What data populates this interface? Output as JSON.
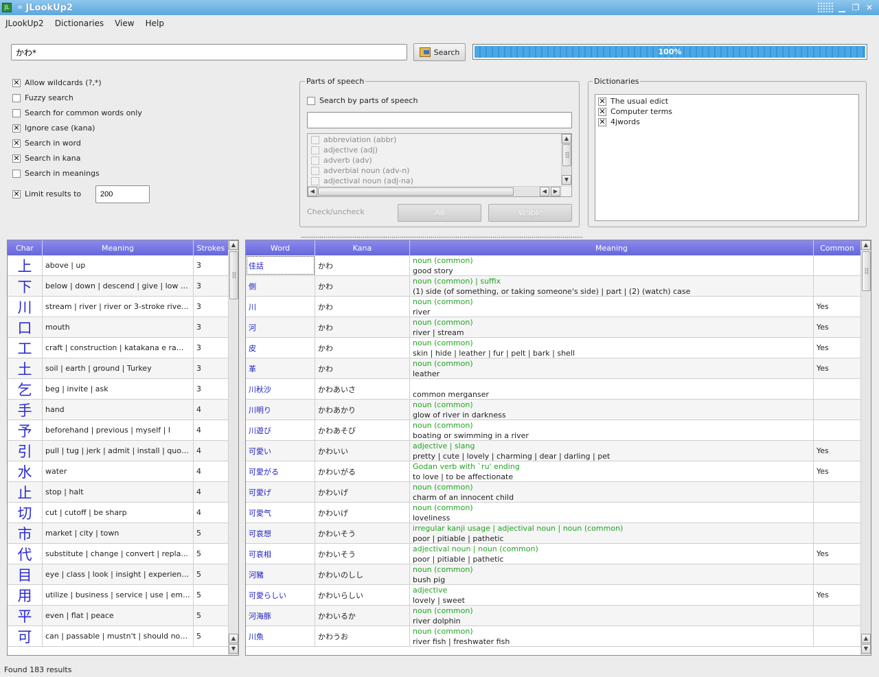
{
  "window": {
    "title": "JLookUp2"
  },
  "menu": [
    "JLookUp2",
    "Dictionaries",
    "View",
    "Help"
  ],
  "search": {
    "value": "かわ*",
    "button_label": "Search"
  },
  "progress": {
    "label": "100%",
    "value": 1.0
  },
  "options": [
    {
      "label": "Allow wildcards (?,*)",
      "checked": true
    },
    {
      "label": "Fuzzy search",
      "checked": false
    },
    {
      "label": "Search for common words only",
      "checked": false
    },
    {
      "label": "Ignore case (kana)",
      "checked": true
    },
    {
      "label": "Search in word",
      "checked": true
    },
    {
      "label": "Search in kana",
      "checked": true
    },
    {
      "label": "Search in meanings",
      "checked": false
    }
  ],
  "limit": {
    "label": "Limit results to",
    "checked": true,
    "value": "200"
  },
  "parts_of_speech": {
    "title": "Parts of speech",
    "search_by_label": "Search by parts of speech",
    "filter_value": "",
    "items": [
      "abbreviation (abbr)",
      "adjective (adj)",
      "adverb (adv)",
      "adverbial noun (adv-n)",
      "adjectival noun (adj-na)"
    ],
    "check_label": "Check/uncheck",
    "all_button": "All",
    "visible_button": "Visible"
  },
  "dictionaries": {
    "title": "Dictionaries",
    "items": [
      {
        "label": "The usual edict",
        "checked": true
      },
      {
        "label": "Computer terms",
        "checked": true
      },
      {
        "label": "4jwords",
        "checked": true
      }
    ]
  },
  "kanji_table": {
    "headers": [
      "Char",
      "Meaning",
      "Strokes"
    ],
    "rows": [
      {
        "char": "上",
        "meaning": "above | up",
        "strokes": "3"
      },
      {
        "char": "下",
        "meaning": "below | down | descend | give | low | i...",
        "strokes": "3"
      },
      {
        "char": "川",
        "meaning": "stream | river | river or 3-stroke rive...",
        "strokes": "3"
      },
      {
        "char": "口",
        "meaning": "mouth",
        "strokes": "3"
      },
      {
        "char": "工",
        "meaning": "craft | construction | katakana e ra...",
        "strokes": "3"
      },
      {
        "char": "土",
        "meaning": "soil | earth | ground | Turkey",
        "strokes": "3"
      },
      {
        "char": "乞",
        "meaning": "beg | invite | ask",
        "strokes": "3"
      },
      {
        "char": "手",
        "meaning": "hand",
        "strokes": "4"
      },
      {
        "char": "予",
        "meaning": "beforehand | previous | myself | I",
        "strokes": "4"
      },
      {
        "char": "引",
        "meaning": "pull | tug | jerk | admit | install | quot...",
        "strokes": "4"
      },
      {
        "char": "水",
        "meaning": "water",
        "strokes": "4"
      },
      {
        "char": "止",
        "meaning": "stop | halt",
        "strokes": "4"
      },
      {
        "char": "切",
        "meaning": "cut | cutoff | be sharp",
        "strokes": "4"
      },
      {
        "char": "市",
        "meaning": "market | city | town",
        "strokes": "5"
      },
      {
        "char": "代",
        "meaning": "substitute | change | convert | repla...",
        "strokes": "5"
      },
      {
        "char": "目",
        "meaning": "eye | class | look | insight | experienc...",
        "strokes": "5"
      },
      {
        "char": "用",
        "meaning": "utilize | business | service | use | em...",
        "strokes": "5"
      },
      {
        "char": "平",
        "meaning": "even | flat | peace",
        "strokes": "5"
      },
      {
        "char": "可",
        "meaning": "can | passable | mustn't | should not...",
        "strokes": "5"
      }
    ]
  },
  "word_table": {
    "headers": [
      "Word",
      "Kana",
      "Meaning",
      "Common"
    ],
    "rows": [
      {
        "word": "佳話",
        "kana": "かわ",
        "pos": "noun (common)",
        "meaning": "good story",
        "common": ""
      },
      {
        "word": "側",
        "kana": "かわ",
        "pos": "noun (common) | suffix",
        "meaning": "(1) side (of something, or taking someone's side) | part | (2) (watch) case",
        "common": ""
      },
      {
        "word": "川",
        "kana": "かわ",
        "pos": "noun (common)",
        "meaning": "river",
        "common": "Yes"
      },
      {
        "word": "河",
        "kana": "かわ",
        "pos": "noun (common)",
        "meaning": "river | stream",
        "common": "Yes"
      },
      {
        "word": "皮",
        "kana": "かわ",
        "pos": "noun (common)",
        "meaning": "skin | hide | leather | fur | pelt | bark | shell",
        "common": "Yes"
      },
      {
        "word": "革",
        "kana": "かわ",
        "pos": "noun (common)",
        "meaning": "leather",
        "common": "Yes"
      },
      {
        "word": "川秋沙",
        "kana": "かわあいさ",
        "pos": "",
        "meaning": "common merganser",
        "common": ""
      },
      {
        "word": "川明り",
        "kana": "かわあかり",
        "pos": "noun (common)",
        "meaning": "glow of river in darkness",
        "common": ""
      },
      {
        "word": "川遊び",
        "kana": "かわあそび",
        "pos": "noun (common)",
        "meaning": "boating or swimming in a river",
        "common": ""
      },
      {
        "word": "可愛い",
        "kana": "かわいい",
        "pos": "adjective | slang",
        "meaning": "pretty | cute | lovely | charming | dear | darling | pet",
        "common": "Yes"
      },
      {
        "word": "可愛がる",
        "kana": "かわいがる",
        "pos": "Godan verb with `ru' ending",
        "meaning": "to love | to be affectionate",
        "common": "Yes"
      },
      {
        "word": "可愛げ",
        "kana": "かわいげ",
        "pos": "noun (common)",
        "meaning": "charm of an innocent child",
        "common": ""
      },
      {
        "word": "可愛气",
        "kana": "かわいげ",
        "pos": "noun (common)",
        "meaning": "loveliness",
        "common": ""
      },
      {
        "word": "可哀想",
        "kana": "かわいそう",
        "pos": "irregular kanji usage | adjectival noun | noun (common)",
        "meaning": "poor | pitiable | pathetic",
        "common": ""
      },
      {
        "word": "可哀相",
        "kana": "かわいそう",
        "pos": "adjectival noun | noun (common)",
        "meaning": "poor | pitiable | pathetic",
        "common": "Yes"
      },
      {
        "word": "河豬",
        "kana": "かわいのしし",
        "pos": "noun (common)",
        "meaning": "bush pig",
        "common": ""
      },
      {
        "word": "可愛らしい",
        "kana": "かわいらしい",
        "pos": "adjective",
        "meaning": "lovely | sweet",
        "common": "Yes"
      },
      {
        "word": "河海豚",
        "kana": "かわいるか",
        "pos": "noun (common)",
        "meaning": "river dolphin",
        "common": ""
      },
      {
        "word": "川魚",
        "kana": "かわうお",
        "pos": "noun (common)",
        "meaning": "river fish | freshwater fish",
        "common": ""
      }
    ]
  },
  "status": {
    "text": "Found 183 results"
  },
  "colors": {
    "header": "#7676e0",
    "pos_green": "#22a322",
    "kanji_blue": "#2a2ad6"
  }
}
